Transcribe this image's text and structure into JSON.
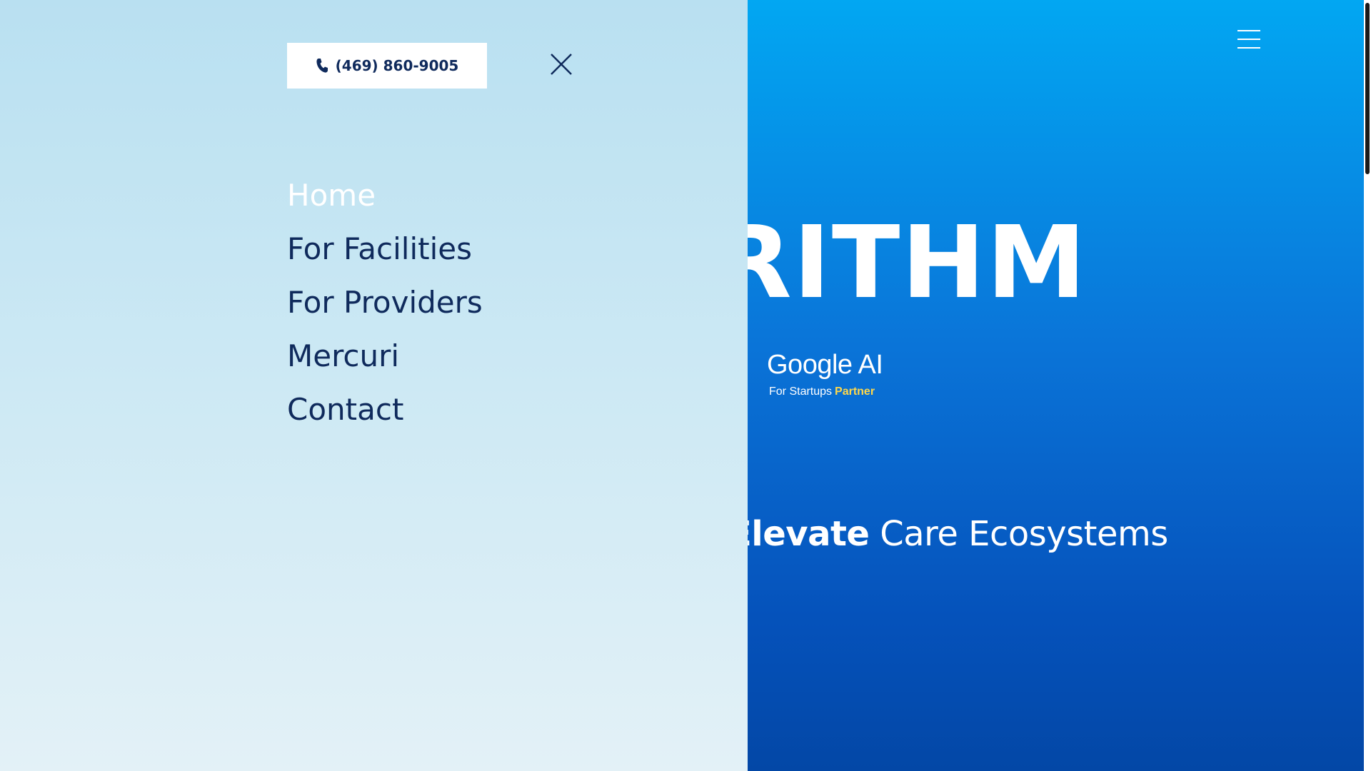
{
  "menu": {
    "phone_label": "(469) 860-9005",
    "items": [
      {
        "label": "Home",
        "active": true
      },
      {
        "label": "For Facilities",
        "active": false
      },
      {
        "label": "For Providers",
        "active": false
      },
      {
        "label": "Mercuri",
        "active": false
      },
      {
        "label": "Contact",
        "active": false
      }
    ],
    "icons": {
      "phone": "phone-icon",
      "close": "close-icon"
    }
  },
  "hero": {
    "logo_text": "ORITHM",
    "partner_title": "Google AI",
    "partner_sub": "For Startups",
    "partner_accent": "Partner",
    "tagline_bold": "Elevate",
    "tagline_rest": " Care Ecosystems"
  },
  "header": {
    "menu_icon": "hamburger-icon"
  },
  "colors": {
    "navy": "#0f2a5c",
    "sky_top": "#02a7f2",
    "deep_blue": "#0347a6",
    "panel_light": "#cde9f4",
    "partner_accent": "#ffd84a"
  }
}
